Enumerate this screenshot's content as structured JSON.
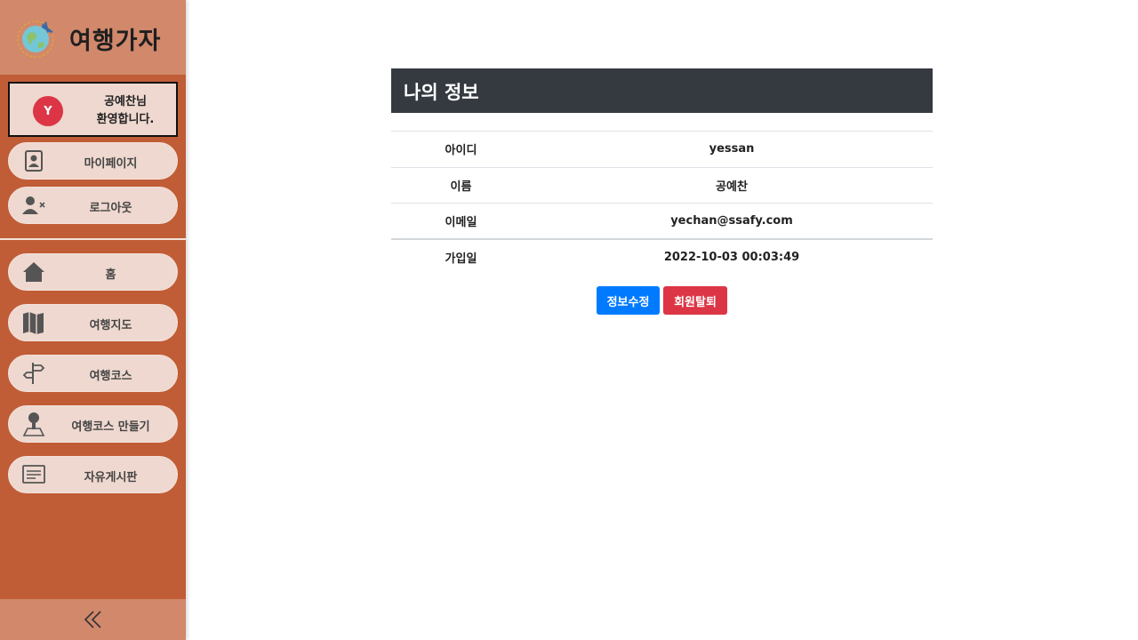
{
  "brand": {
    "logo_text": "여행가자"
  },
  "user": {
    "avatar_letter": "Y",
    "welcome_line1": "공예찬님",
    "welcome_line2": "환영합니다."
  },
  "account_menu": [
    {
      "label": "마이페이지",
      "icon": "contact-card-icon"
    },
    {
      "label": "로그아웃",
      "icon": "user-remove-icon"
    }
  ],
  "nav_menu": [
    {
      "label": "홈",
      "icon": "home-icon"
    },
    {
      "label": "여행지도",
      "icon": "map-icon"
    },
    {
      "label": "여행코스",
      "icon": "signpost-icon"
    },
    {
      "label": "여행코스 만들기",
      "icon": "map-pin-person-icon"
    },
    {
      "label": "자유게시판",
      "icon": "board-icon"
    }
  ],
  "page": {
    "title": "나의 정보",
    "rows": [
      {
        "key": "아이디",
        "value": "yessan"
      },
      {
        "key": "이름",
        "value": "공예찬"
      },
      {
        "key": "이메일",
        "value": "yechan@ssafy.com"
      },
      {
        "key": "가입일",
        "value": "2022-10-03 00:03:49"
      }
    ],
    "edit_button": "정보수정",
    "withdraw_button": "회원탈퇴"
  },
  "colors": {
    "sidebar": "#c05d37",
    "sidebar_header": "#d1886b",
    "pill": "#eed8cf",
    "title_bar": "#343a40",
    "primary": "#007bff",
    "danger": "#dc3545"
  }
}
